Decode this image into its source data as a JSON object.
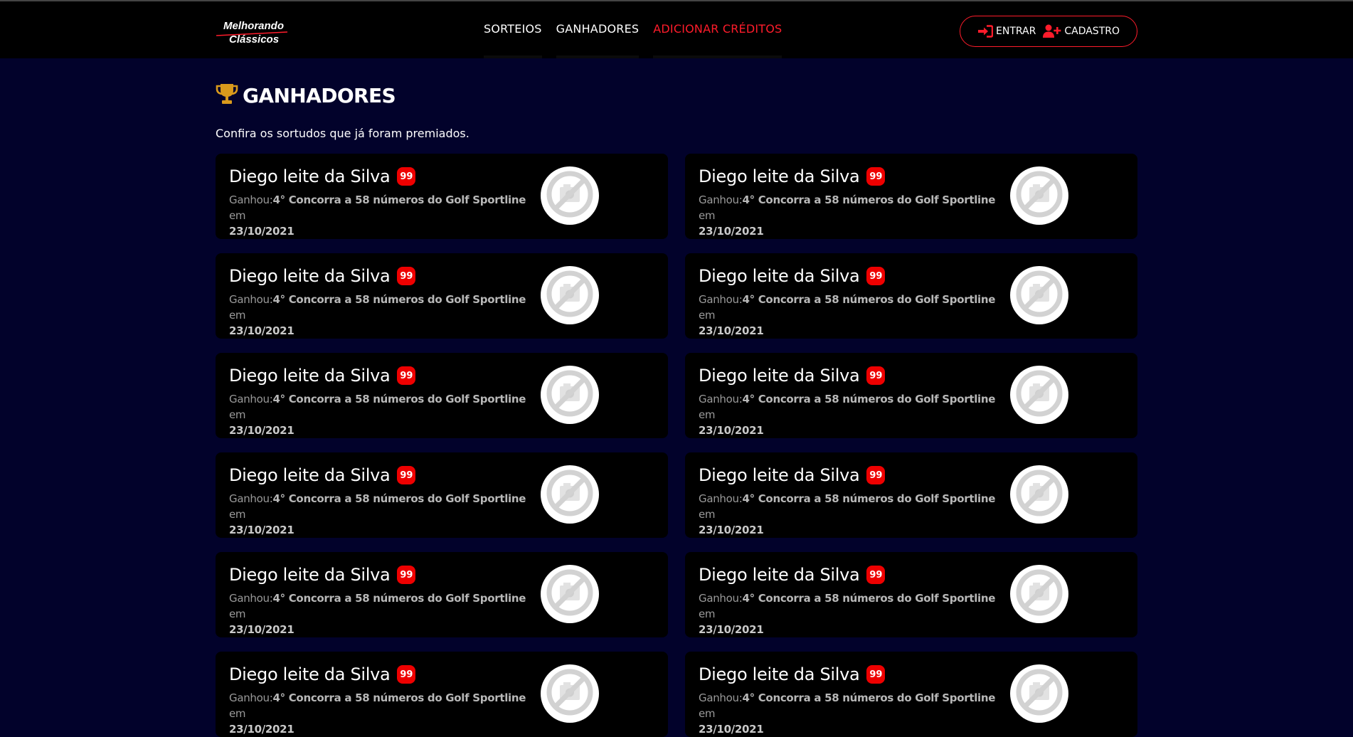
{
  "colors": {
    "accent": "#ff1c2b",
    "background": "#02022b",
    "card": "#000000",
    "badge": "#ee0000",
    "trophy": "#d99a1c"
  },
  "header": {
    "logo": {
      "line1": "Melhorando",
      "line2": "Clássicos"
    },
    "nav": [
      {
        "label": "SORTEIOS",
        "active": false
      },
      {
        "label": "GANHADORES",
        "active": false
      },
      {
        "label": "ADICIONAR CRÉDITOS",
        "active": true
      }
    ],
    "auth": {
      "login_label": "ENTRAR",
      "login_icon": "sign-in-icon",
      "register_label": "CADASTRO",
      "register_icon": "user-plus-icon"
    }
  },
  "main": {
    "title": "GANHADORES",
    "title_icon": "trophy-icon",
    "subtitle": "Confira os sortudos que já foram premiados.",
    "winners": [
      {
        "name": "Diego leite da Silva",
        "number": "99",
        "won_label": "Ganhou:",
        "prize": "4° Concorra a 58 números do Golf Sportline",
        "on_label": "em",
        "date": "23/10/2021"
      },
      {
        "name": "Diego leite da Silva",
        "number": "99",
        "won_label": "Ganhou:",
        "prize": "4° Concorra a 58 números do Golf Sportline",
        "on_label": "em",
        "date": "23/10/2021"
      },
      {
        "name": "Diego leite da Silva",
        "number": "99",
        "won_label": "Ganhou:",
        "prize": "4° Concorra a 58 números do Golf Sportline",
        "on_label": "em",
        "date": "23/10/2021"
      },
      {
        "name": "Diego leite da Silva",
        "number": "99",
        "won_label": "Ganhou:",
        "prize": "4° Concorra a 58 números do Golf Sportline",
        "on_label": "em",
        "date": "23/10/2021"
      },
      {
        "name": "Diego leite da Silva",
        "number": "99",
        "won_label": "Ganhou:",
        "prize": "4° Concorra a 58 números do Golf Sportline",
        "on_label": "em",
        "date": "23/10/2021"
      },
      {
        "name": "Diego leite da Silva",
        "number": "99",
        "won_label": "Ganhou:",
        "prize": "4° Concorra a 58 números do Golf Sportline",
        "on_label": "em",
        "date": "23/10/2021"
      },
      {
        "name": "Diego leite da Silva",
        "number": "99",
        "won_label": "Ganhou:",
        "prize": "4° Concorra a 58 números do Golf Sportline",
        "on_label": "em",
        "date": "23/10/2021"
      },
      {
        "name": "Diego leite da Silva",
        "number": "99",
        "won_label": "Ganhou:",
        "prize": "4° Concorra a 58 números do Golf Sportline",
        "on_label": "em",
        "date": "23/10/2021"
      },
      {
        "name": "Diego leite da Silva",
        "number": "99",
        "won_label": "Ganhou:",
        "prize": "4° Concorra a 58 números do Golf Sportline",
        "on_label": "em",
        "date": "23/10/2021"
      },
      {
        "name": "Diego leite da Silva",
        "number": "99",
        "won_label": "Ganhou:",
        "prize": "4° Concorra a 58 números do Golf Sportline",
        "on_label": "em",
        "date": "23/10/2021"
      },
      {
        "name": "Diego leite da Silva",
        "number": "99",
        "won_label": "Ganhou:",
        "prize": "4° Concorra a 58 números do Golf Sportline",
        "on_label": "em",
        "date": "23/10/2021"
      },
      {
        "name": "Diego leite da Silva",
        "number": "99",
        "won_label": "Ganhou:",
        "prize": "4° Concorra a 58 números do Golf Sportline",
        "on_label": "em",
        "date": "23/10/2021"
      }
    ],
    "thumb_icon": "no-image-icon"
  }
}
